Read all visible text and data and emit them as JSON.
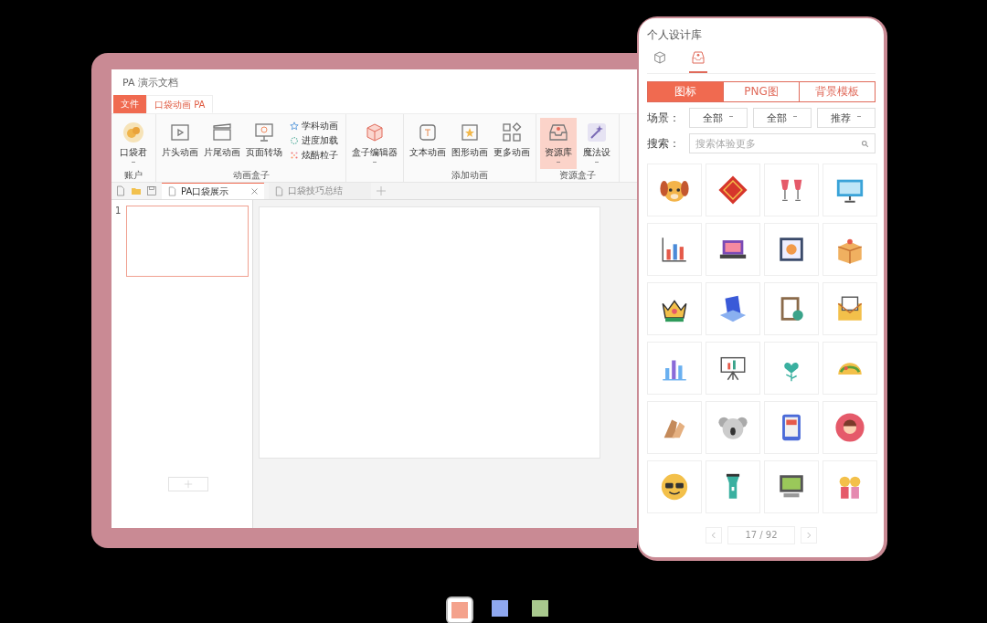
{
  "window": {
    "title": "PA 演示文档"
  },
  "menu_tabs": [
    {
      "label": "文件",
      "kind": "file",
      "selected": false
    },
    {
      "label": "口袋动画 PA",
      "kind": "tab",
      "selected": true
    }
  ],
  "ribbon_groups": [
    {
      "label": "账户",
      "items": [
        {
          "kind": "large",
          "label": "口袋君",
          "dropdown": true,
          "selected": false
        }
      ]
    },
    {
      "label": "动画盒子",
      "items": [
        {
          "kind": "large",
          "label": "片头动画",
          "dropdown": false,
          "selected": false
        },
        {
          "kind": "large",
          "label": "片尾动画",
          "dropdown": false,
          "selected": false
        },
        {
          "kind": "large",
          "label": "页面转场",
          "dropdown": false,
          "selected": false
        },
        {
          "kind": "stack",
          "items": [
            {
              "label": "学科动画"
            },
            {
              "label": "进度加载"
            },
            {
              "label": "炫酷粒子"
            }
          ]
        }
      ]
    },
    {
      "items": [
        {
          "kind": "large",
          "label": "盒子编辑器",
          "dropdown": true,
          "selected": false
        }
      ]
    },
    {
      "label": "添加动画",
      "items": [
        {
          "kind": "large",
          "label": "文本动画",
          "dropdown": false,
          "selected": false
        },
        {
          "kind": "large",
          "label": "图形动画",
          "dropdown": false,
          "selected": false
        },
        {
          "kind": "large",
          "label": "更多动画",
          "dropdown": false,
          "selected": false
        }
      ]
    },
    {
      "label": "资源盒子",
      "items": [
        {
          "kind": "large",
          "label": "资源库",
          "dropdown": true,
          "selected": true
        },
        {
          "kind": "large",
          "label": "魔法设",
          "dropdown": true,
          "selected": false
        }
      ]
    }
  ],
  "doc_tabs": [
    {
      "label": "PA口袋展示",
      "selected": true
    },
    {
      "label": "口袋技巧总结",
      "selected": false
    }
  ],
  "slides": [
    {
      "number": "1",
      "selected": true
    }
  ],
  "panel": {
    "title": "个人设计库",
    "view_tabs": [
      {
        "selected": false
      },
      {
        "selected": true
      }
    ],
    "categories": [
      {
        "label": "图标",
        "selected": true
      },
      {
        "label": "PNG图",
        "selected": false
      },
      {
        "label": "背景模板",
        "selected": false
      }
    ],
    "filter": {
      "label": "场景：",
      "dropdowns": [
        "全部",
        "全部",
        "推荐"
      ]
    },
    "search": {
      "label": "搜索：",
      "placeholder": "搜索体验更多"
    },
    "page": "17 / 92"
  },
  "carousel": [
    {
      "color": "#f4a28c",
      "selected": true
    },
    {
      "color": "#8fa8f0",
      "selected": false
    },
    {
      "color": "#a9c98e",
      "selected": false
    }
  ]
}
